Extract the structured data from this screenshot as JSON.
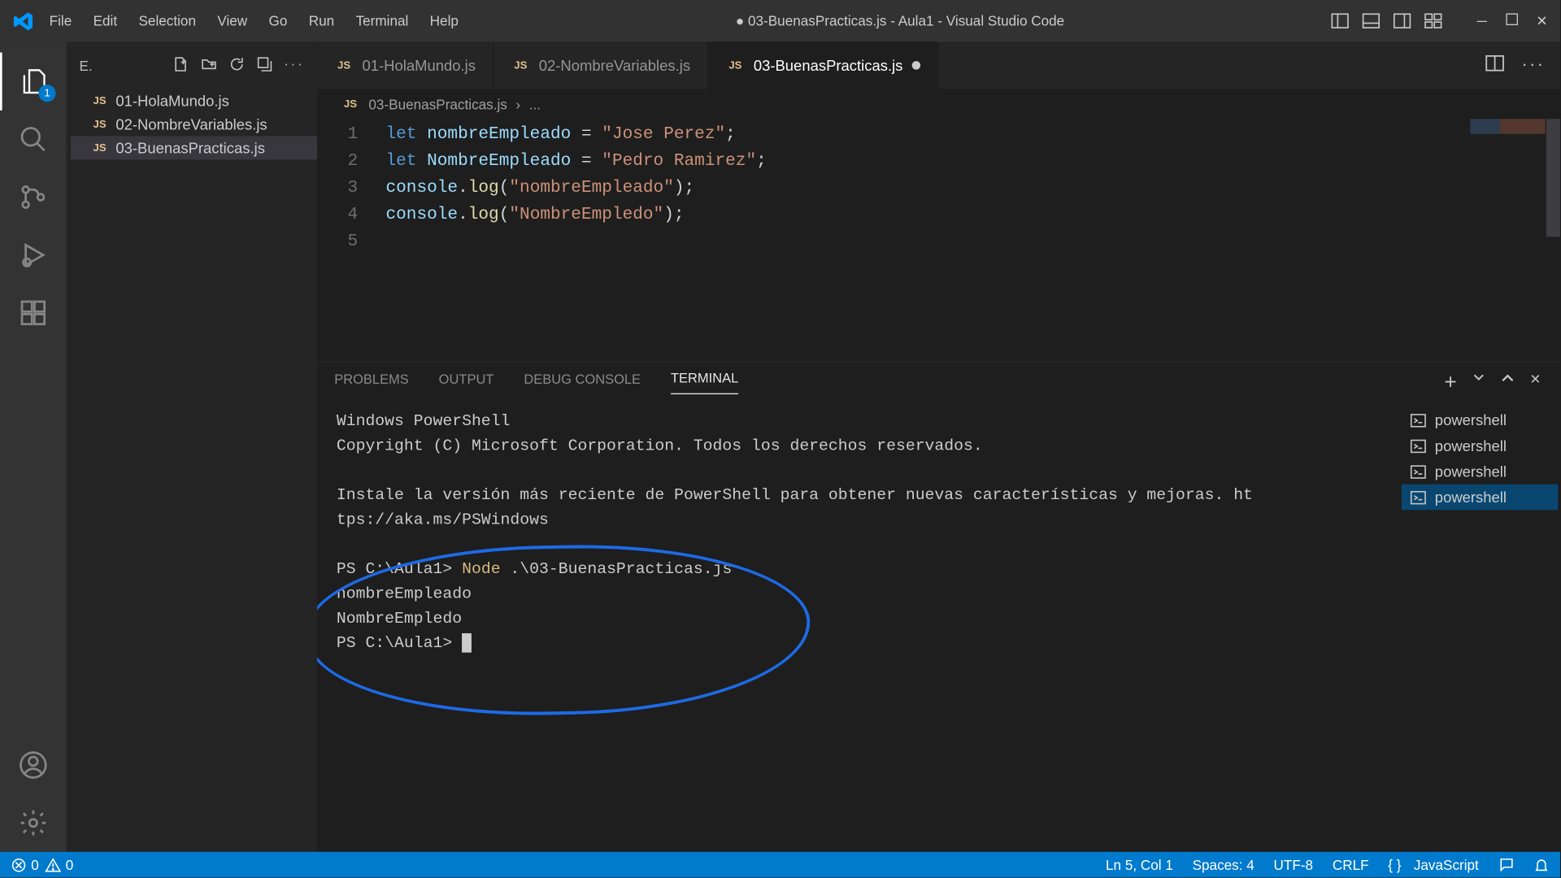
{
  "menu": {
    "file": "File",
    "edit": "Edit",
    "selection": "Selection",
    "view": "View",
    "go": "Go",
    "run": "Run",
    "terminal": "Terminal",
    "help": "Help"
  },
  "window_title": "● 03-BuenasPracticas.js - Aula1 - Visual Studio Code",
  "explorer_badge": "1",
  "sidebar": {
    "header_initial": "E.",
    "files": [
      "01-HolaMundo.js",
      "02-NombreVariables.js",
      "03-BuenasPracticas.js"
    ]
  },
  "tabs": [
    {
      "name": "01-HolaMundo.js",
      "modified": false
    },
    {
      "name": "02-NombreVariables.js",
      "modified": false
    },
    {
      "name": "03-BuenasPracticas.js",
      "modified": true
    }
  ],
  "active_tab": "03-BuenasPracticas.js",
  "breadcrumb": {
    "file": "03-BuenasPracticas.js",
    "sep": "›",
    "more": "..."
  },
  "code_lines": [
    {
      "n": 1,
      "tokens": [
        [
          "kw",
          "let"
        ],
        [
          "sp",
          " "
        ],
        [
          "var",
          "nombreEmpleado"
        ],
        [
          "sp",
          " "
        ],
        [
          "op",
          "="
        ],
        [
          "sp",
          " "
        ],
        [
          "str",
          "\"Jose Perez\""
        ],
        [
          "punc",
          ";"
        ]
      ]
    },
    {
      "n": 2,
      "tokens": [
        [
          "kw",
          "let"
        ],
        [
          "sp",
          " "
        ],
        [
          "var",
          "NombreEmpleado"
        ],
        [
          "sp",
          " "
        ],
        [
          "op",
          "="
        ],
        [
          "sp",
          " "
        ],
        [
          "str",
          "\"Pedro Ramirez\""
        ],
        [
          "punc",
          ";"
        ]
      ]
    },
    {
      "n": 3,
      "tokens": [
        [
          "obj",
          "console"
        ],
        [
          "punc",
          "."
        ],
        [
          "fn",
          "log"
        ],
        [
          "punc",
          "("
        ],
        [
          "str",
          "\"nombreEmpleado\""
        ],
        [
          "punc",
          ")"
        ],
        [
          "punc",
          ";"
        ]
      ]
    },
    {
      "n": 4,
      "tokens": [
        [
          "obj",
          "console"
        ],
        [
          "punc",
          "."
        ],
        [
          "fn",
          "log"
        ],
        [
          "punc",
          "("
        ],
        [
          "str",
          "\"NombreEmpledo\""
        ],
        [
          "punc",
          ")"
        ],
        [
          "punc",
          ";"
        ]
      ]
    },
    {
      "n": 5,
      "tokens": []
    }
  ],
  "panel": {
    "tabs": [
      "PROBLEMS",
      "OUTPUT",
      "DEBUG CONSOLE",
      "TERMINAL"
    ],
    "active": "TERMINAL"
  },
  "terminal": {
    "lines": [
      "Windows PowerShell",
      "Copyright (C) Microsoft Corporation. Todos los derechos reservados.",
      "",
      "Instale la versión más reciente de PowerShell para obtener nuevas características y mejoras. ht",
      "tps://aka.ms/PSWindows",
      ""
    ],
    "prompt1_prefix": "PS C:\\Aula1> ",
    "prompt1_cmd": "Node",
    "prompt1_arg": " .\\03-BuenasPracticas.js",
    "out1": "nombreEmpleado",
    "out2": "NombreEmpledo",
    "prompt2": "PS C:\\Aula1> "
  },
  "terminal_list": [
    "powershell",
    "powershell",
    "powershell",
    "powershell"
  ],
  "terminal_list_active": 3,
  "status": {
    "errors": "0",
    "warnings": "0",
    "cursor": "Ln 5, Col 1",
    "spaces": "Spaces: 4",
    "encoding": "UTF-8",
    "eol": "CRLF",
    "lang": "JavaScript"
  }
}
